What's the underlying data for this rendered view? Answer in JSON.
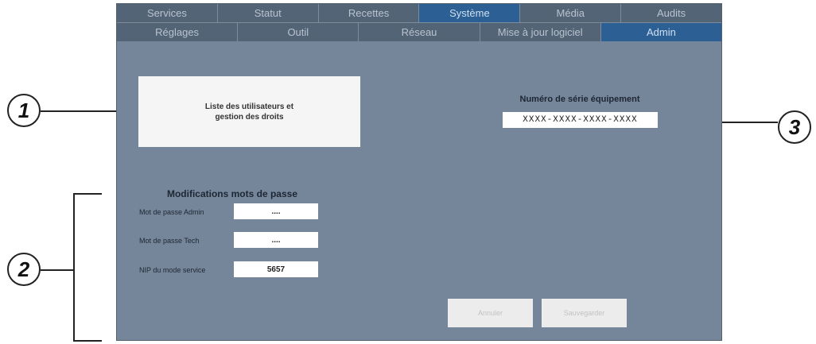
{
  "tabs_top": [
    {
      "label": "Services",
      "active": false
    },
    {
      "label": "Statut",
      "active": false
    },
    {
      "label": "Recettes",
      "active": false
    },
    {
      "label": "Système",
      "active": true
    },
    {
      "label": "Média",
      "active": false
    },
    {
      "label": "Audits",
      "active": false
    }
  ],
  "tabs_sub": [
    {
      "label": "Réglages",
      "active": false
    },
    {
      "label": "Outil",
      "active": false
    },
    {
      "label": "Réseau",
      "active": false
    },
    {
      "label": "Mise à jour logiciel",
      "active": false
    },
    {
      "label": "Admin",
      "active": true
    }
  ],
  "users_card": {
    "label": "Liste des utilisateurs et gestion des droits"
  },
  "serial": {
    "title": "Numéro de série équipement",
    "value": "XXXX-XXXX-XXXX-XXXX"
  },
  "passwords": {
    "title": "Modifications mots de passe",
    "admin_label": "Mot de passe Admin",
    "admin_value": "....",
    "tech_label": "Mot de passe Tech",
    "tech_value": "....",
    "pin_label": "NIP du mode service",
    "pin_value": "5657"
  },
  "buttons": {
    "cancel": "Annuler",
    "save": "Sauvegarder"
  },
  "callouts": {
    "one": "1",
    "two": "2",
    "three": "3"
  },
  "colors": {
    "screen_bg": "#76869a",
    "tab_bg": "#536477",
    "tab_active": "#2c5f94"
  }
}
